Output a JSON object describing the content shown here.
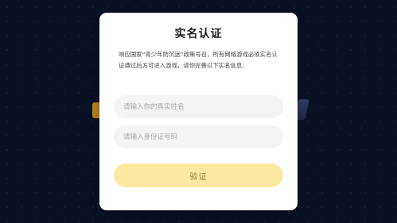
{
  "dialog": {
    "title": "实名认证",
    "notice": "响应国家“青少年防沉迷”政策号召，所有网络游戏必须实名认证通过后方可进入游戏，请你完善以下实名信息：",
    "name_placeholder": "请输入你的真实姓名",
    "id_placeholder": "请输入身份证号码",
    "verify_label": "验证"
  },
  "colors": {
    "background": "#0b1124",
    "dialog_bg": "#ffffff",
    "input_bg": "#f4f4f4",
    "button_bg": "#fbe9a1",
    "button_text": "#8a7d52"
  }
}
